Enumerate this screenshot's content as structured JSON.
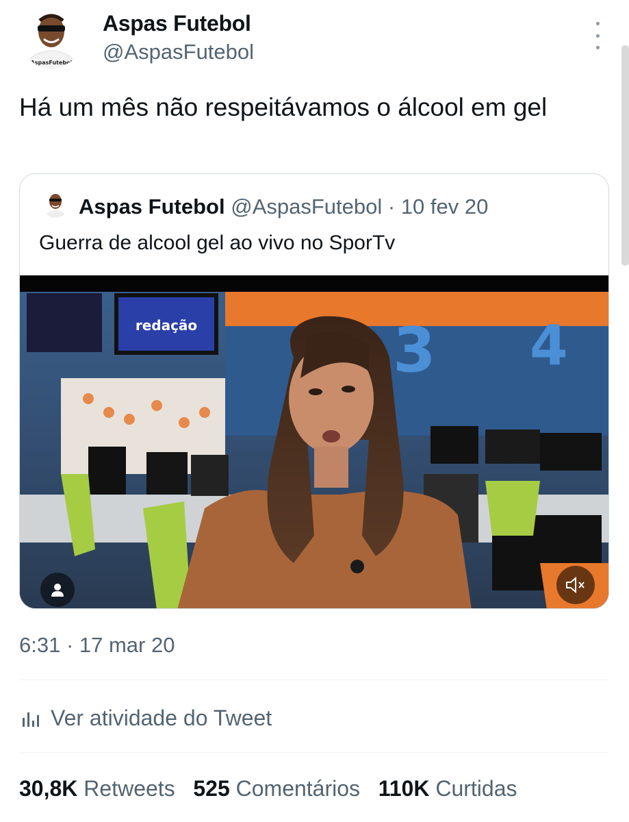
{
  "author": {
    "name": "Aspas Futebol",
    "handle": "@AspasFutebol",
    "avatar_caption": "AspasFutebol"
  },
  "tweet": {
    "text": "Há um mês não respeitávamos o álcool em gel",
    "timestamp": "6:31 · 17 mar 20"
  },
  "quoted": {
    "name": "Aspas Futebol",
    "handle": "@AspasFutebol",
    "separator": " · ",
    "date": "10 fev 20",
    "text": "Guerra de alcool gel ao vivo no SporTv",
    "screen_sign": "redação"
  },
  "activity_label": "Ver atividade do Tweet",
  "stats": {
    "retweets_count": "30,8K",
    "retweets_label": "Retweets",
    "comments_count": "525",
    "comments_label": "Comentários",
    "likes_count": "110K",
    "likes_label": "Curtidas"
  },
  "icons": {
    "more": "more-vertical-icon",
    "activity": "bar-chart-icon",
    "user": "user-icon",
    "mute": "volume-muted-icon"
  },
  "colors": {
    "text": "#0f1419",
    "secondary": "#536471",
    "border": "#cfd9de"
  }
}
